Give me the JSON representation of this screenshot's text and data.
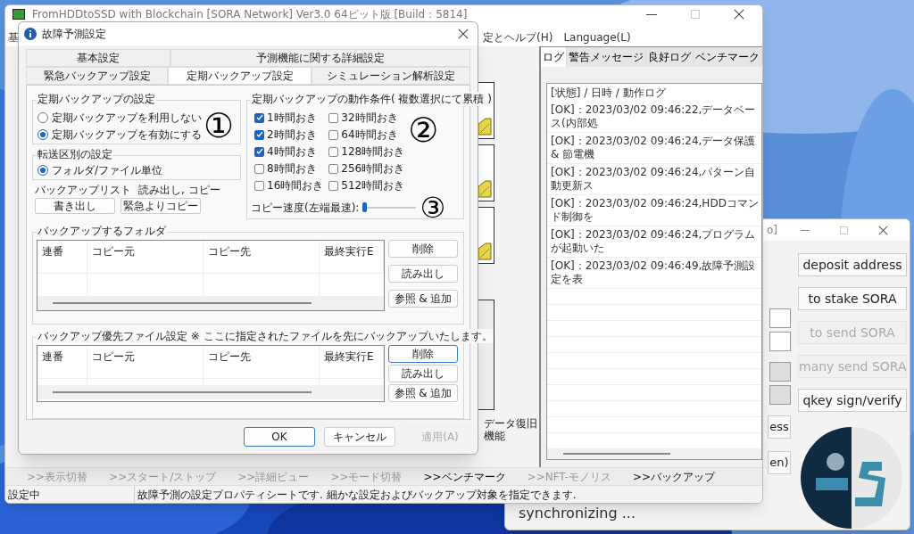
{
  "main_window": {
    "title": "FromHDDtoSSD with Blockchain [SORA Network] Ver3.0 64ビット版 [Build：5814]",
    "menu": [
      "基",
      "定とヘルプ(H)",
      "Language(L)"
    ],
    "side_label": "データ復旧機能",
    "log_tabs": [
      {
        "label": "ログ",
        "selected": true
      },
      {
        "label": "警告メッセージ",
        "selected": false
      },
      {
        "label": "良好ログ",
        "selected": false
      },
      {
        "label": "ベンチマーク",
        "selected": false
      }
    ],
    "log_header": "[状態] / 日時 / 動作ログ",
    "log_entries": [
      "[OK]：2023/03/02 09:46:22,データベース(内部処",
      "[OK]：2023/03/02 09:46:24,データ保護 & 節電機",
      "[OK]：2023/03/02 09:46:24,パターン自動更新ス",
      "[OK]：2023/03/02 09:46:24,HDDコマンド制御を",
      "[OK]：2023/03/02 09:46:24,プログラムが起動いた",
      "[OK]：2023/03/02 09:46:49,故障予測設定を表"
    ],
    "toolbar": [
      {
        "label": ">>表示切替",
        "disabled": true
      },
      {
        "label": ">>スタート/ストップ",
        "disabled": true
      },
      {
        "label": ">>詳細ビュー",
        "disabled": true
      },
      {
        "label": ">>モード切替",
        "disabled": true
      },
      {
        "label": ">>ベンチマーク",
        "disabled": false
      },
      {
        "label": ">>NFT-モノリス",
        "disabled": true
      },
      {
        "label": ">>バックアップ",
        "disabled": false
      }
    ],
    "status": [
      "設定中",
      "故障予測の設定プロパティシートです. 細かな設定およびバックアップ対象を指定できます."
    ]
  },
  "wallet_window": {
    "title": "o]",
    "buttons": [
      {
        "label": "deposit address",
        "disabled": false
      },
      {
        "label": "to stake SORA",
        "disabled": false
      },
      {
        "label": "to send SORA",
        "disabled": true
      },
      {
        "label": "many send SORA",
        "disabled": true
      },
      {
        "label": "qkey sign/verify",
        "disabled": false
      }
    ],
    "partial_buttons": [
      "ess",
      "en)"
    ],
    "status": "synchronizing ..."
  },
  "dialog": {
    "title": "故障予測設定",
    "tab_rows": [
      [
        {
          "label": "基本設定",
          "selected": false
        },
        {
          "label": "予測機能に関する詳細設定",
          "selected": false
        }
      ],
      [
        {
          "label": "緊急バックアップ設定",
          "selected": false
        },
        {
          "label": "定期バックアップ設定",
          "selected": true
        },
        {
          "label": "シミュレーション解析設定",
          "selected": false
        }
      ]
    ],
    "backup_mode": {
      "title": "定期バックアップの設定",
      "options": [
        {
          "label": "定期バックアップを利用しない",
          "selected": false
        },
        {
          "label": "定期バックアップを有効にする",
          "selected": true
        }
      ]
    },
    "transfer": {
      "title": "転送区別の設定",
      "options": [
        {
          "label": "フォルダ/ファイル単位",
          "selected": true
        }
      ]
    },
    "backup_list": {
      "labels": [
        "バックアップリスト",
        "読み出し, コピー"
      ],
      "buttons": [
        "書き出し",
        "緊急よりコピー"
      ]
    },
    "conditions": {
      "title": "定期バックアップの動作条件( 複数選択にて累積 )",
      "options": [
        {
          "label": "1時間おき",
          "checked": true
        },
        {
          "label": "2時間おき",
          "checked": true
        },
        {
          "label": "4時間おき",
          "checked": true
        },
        {
          "label": "8時間おき",
          "checked": false
        },
        {
          "label": "16時間おき",
          "checked": false
        },
        {
          "label": "32時間おき",
          "checked": false
        },
        {
          "label": "64時間おき",
          "checked": false
        },
        {
          "label": "128時間おき",
          "checked": false
        },
        {
          "label": "256時間おき",
          "checked": false
        },
        {
          "label": "512時間おき",
          "checked": false
        }
      ],
      "speed_label": "コピー速度(左端最速):",
      "speed": {
        "level": 0
      }
    },
    "tables": [
      {
        "title": "バックアップするフォルダ",
        "columns": [
          "連番",
          "コピー元",
          "コピー先",
          "最終実行E"
        ],
        "buttons": [
          {
            "label": "削除",
            "focused": false
          },
          {
            "label": "読み出し",
            "focused": false
          },
          {
            "label": "参照 & 追加",
            "focused": false
          }
        ]
      },
      {
        "title": "バックアップ優先ファイル設定 ※ ここに指定されたファイルを先にバックアップいたします。",
        "columns": [
          "連番",
          "コピー元",
          "コピー先",
          "最終実行E"
        ],
        "buttons": [
          {
            "label": "削除",
            "focused": true
          },
          {
            "label": "読み出し",
            "focused": false
          },
          {
            "label": "参照 & 追加",
            "focused": false
          }
        ]
      }
    ],
    "buttons": [
      {
        "label": "OK",
        "default": true,
        "disabled": false
      },
      {
        "label": "キャンセル",
        "default": false,
        "disabled": false
      },
      {
        "label": "適用(A)",
        "default": false,
        "disabled": true
      }
    ]
  },
  "annotations": [
    "①",
    "②",
    "③"
  ]
}
